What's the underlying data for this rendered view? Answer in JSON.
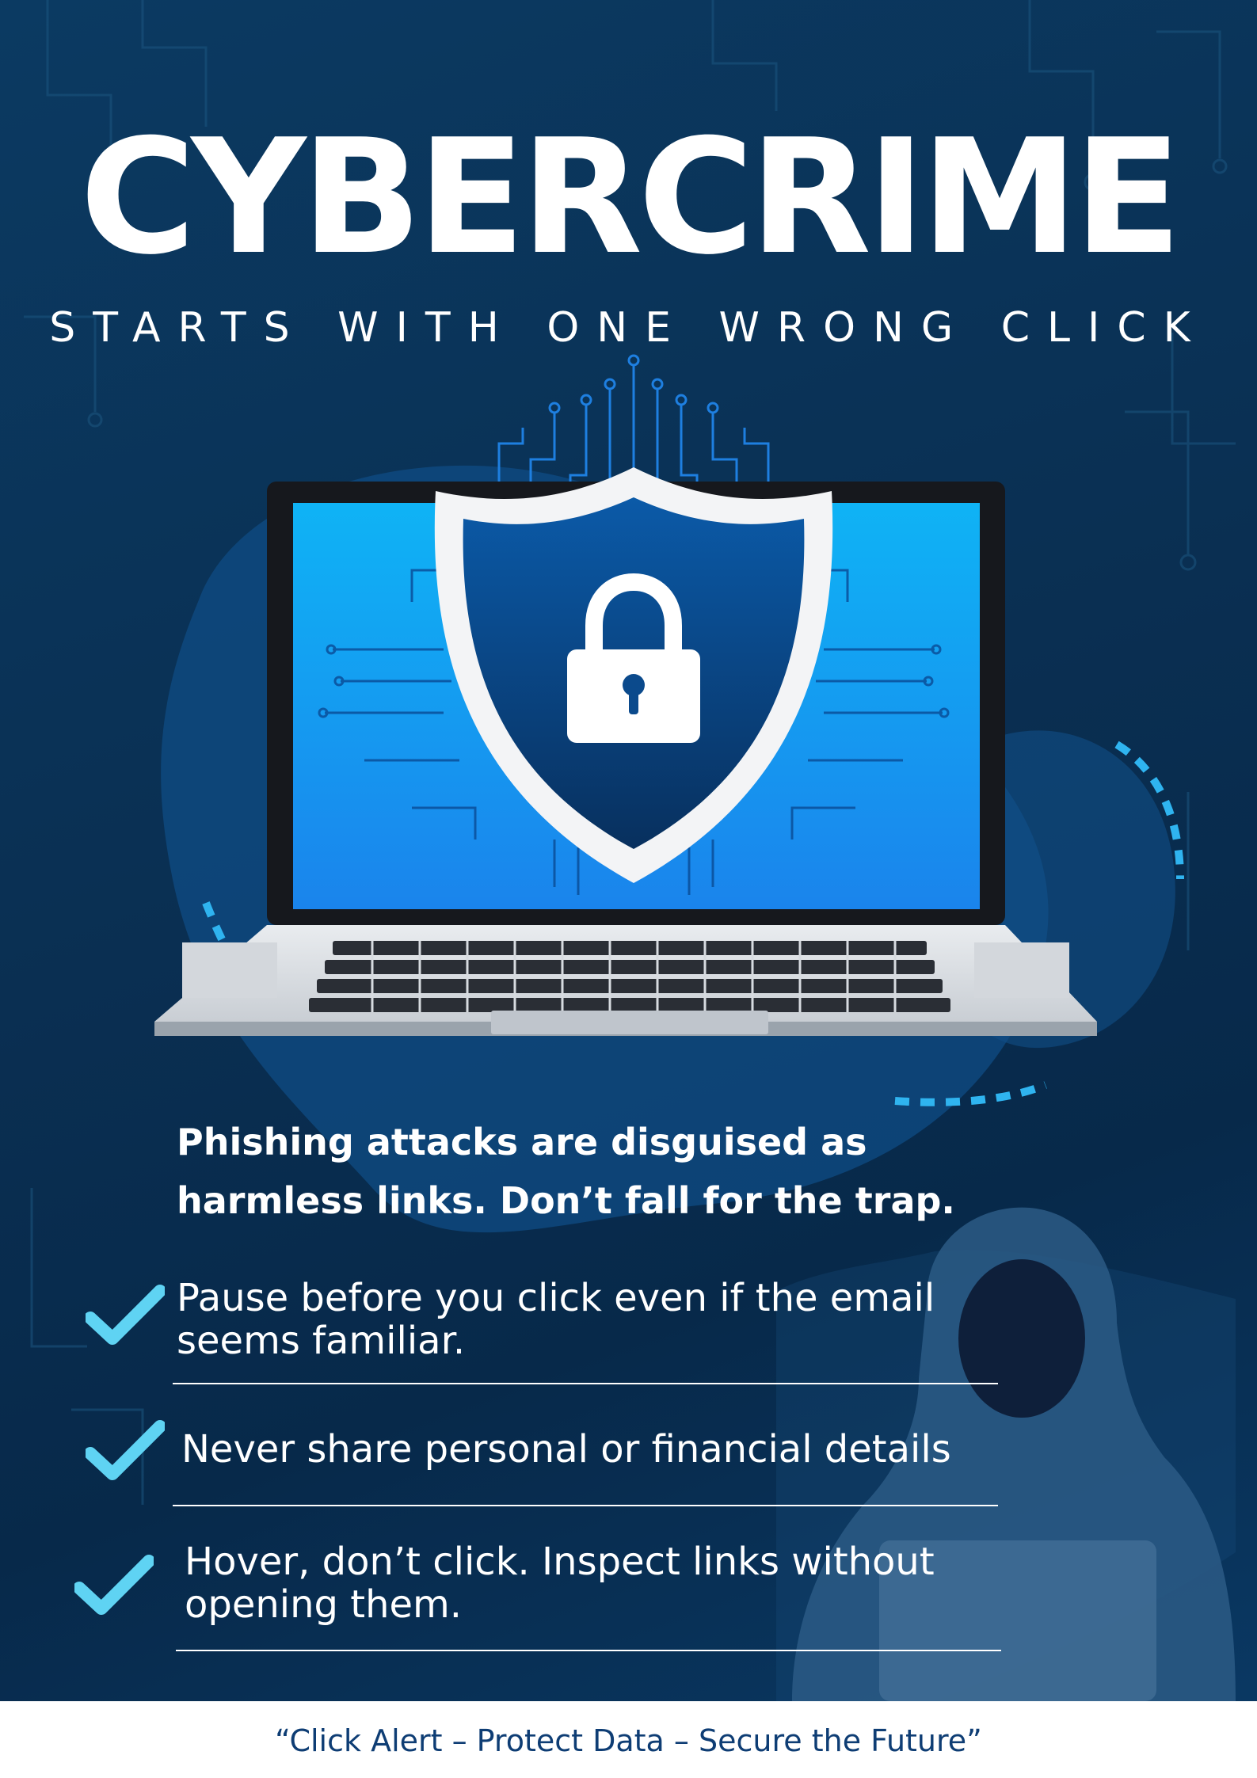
{
  "poster": {
    "title": "CYBERCRIME",
    "subtitle": "STARTS WITH ONE WRONG CLICK",
    "lead": "Phishing attacks are disguised as harmless links. Don’t fall for the trap.",
    "tips": [
      {
        "text": "Pause before you click  even if the email seems familiar."
      },
      {
        "text": "Never share personal or financial details"
      },
      {
        "text": "Hover, don’t click. Inspect links without opening them."
      }
    ],
    "footer": "“Click Alert – Protect Data – Secure the Future”"
  },
  "colors": {
    "background": "#0a2f52",
    "screen": "#1e90f0",
    "accent": "#5fd3f3",
    "footer_text": "#0e3d74"
  },
  "icons": [
    "check-icon",
    "shield-icon",
    "padlock-icon",
    "laptop-icon",
    "hacker-figure-icon"
  ]
}
